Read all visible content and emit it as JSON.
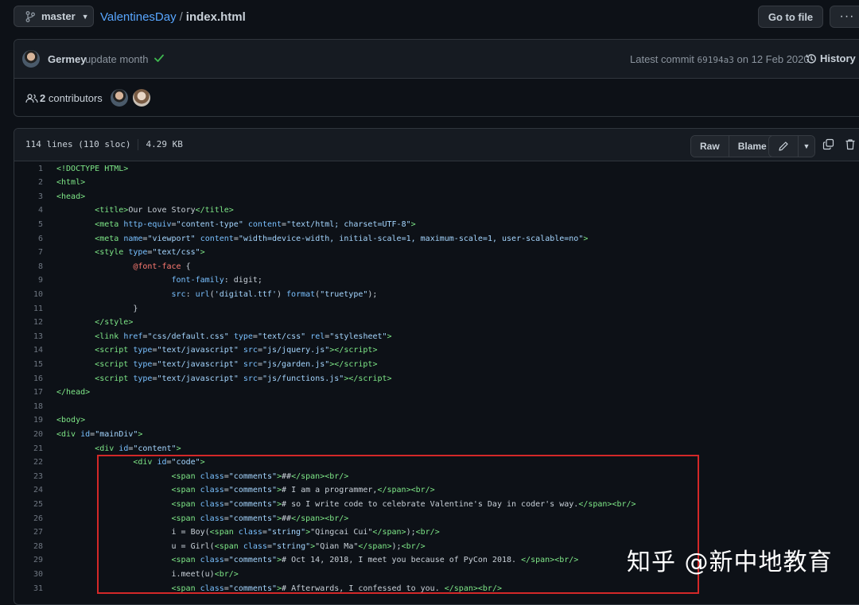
{
  "topbar": {
    "branch": "master",
    "repo": "ValentinesDay",
    "separator": "/",
    "file": "index.html",
    "goto_label": "Go to file",
    "more_label": "···"
  },
  "commit": {
    "author": "Germey",
    "message": "update month",
    "latest_prefix": "Latest commit",
    "sha": "69194a3",
    "date": "on 12 Feb 2020",
    "history_label": "History"
  },
  "contributors": {
    "count": "2",
    "label": "contributors"
  },
  "file_header": {
    "lines": "114 lines (110 sloc)",
    "size": "4.29 KB",
    "raw_label": "Raw",
    "blame_label": "Blame"
  },
  "code_lines": [
    {
      "n": "1",
      "html": "<span class='t'>&lt;!DOCTYPE HTML&gt;</span>"
    },
    {
      "n": "2",
      "html": "<span class='t'>&lt;html&gt;</span>"
    },
    {
      "n": "3",
      "html": "<span class='t'>&lt;head&gt;</span>"
    },
    {
      "n": "4",
      "html": "        <span class='t'>&lt;title&gt;</span>Our Love Story<span class='t'>&lt;/title&gt;</span>"
    },
    {
      "n": "5",
      "html": "        <span class='t'>&lt;meta</span> <span class='a'>http-equiv</span>=<span class='s'>\"content-type\"</span> <span class='a'>content</span>=<span class='s'>\"text/html; charset=UTF-8\"</span><span class='t'>&gt;</span>"
    },
    {
      "n": "6",
      "html": "        <span class='t'>&lt;meta</span> <span class='a'>name</span>=<span class='s'>\"viewport\"</span> <span class='a'>content</span>=<span class='s'>\"width=device-width, initial-scale=1, maximum-scale=1, user-scalable=no\"</span><span class='t'>&gt;</span>"
    },
    {
      "n": "7",
      "html": "        <span class='t'>&lt;style</span> <span class='a'>type</span>=<span class='s'>\"text/css\"</span><span class='t'>&gt;</span>"
    },
    {
      "n": "8",
      "html": "                <span class='k'>@font-face</span> {"
    },
    {
      "n": "9",
      "html": "                        <span class='a'>font-family</span>: digit;"
    },
    {
      "n": "10",
      "html": "                        <span class='a'>src</span>: <span class='a'>url</span>(<span class='s'>'digital.ttf'</span>) <span class='a'>format</span>(<span class='s'>\"truetype\"</span>);"
    },
    {
      "n": "11",
      "html": "                }"
    },
    {
      "n": "12",
      "html": "        <span class='t'>&lt;/style&gt;</span>"
    },
    {
      "n": "13",
      "html": "        <span class='t'>&lt;link</span> <span class='a'>href</span>=<span class='s'>\"css/default.css\"</span> <span class='a'>type</span>=<span class='s'>\"text/css\"</span> <span class='a'>rel</span>=<span class='s'>\"stylesheet\"</span><span class='t'>&gt;</span>"
    },
    {
      "n": "14",
      "html": "        <span class='t'>&lt;script</span> <span class='a'>type</span>=<span class='s'>\"text/javascript\"</span> <span class='a'>src</span>=<span class='s'>\"js/jquery.js\"</span><span class='t'>&gt;&lt;/script&gt;</span>"
    },
    {
      "n": "15",
      "html": "        <span class='t'>&lt;script</span> <span class='a'>type</span>=<span class='s'>\"text/javascript\"</span> <span class='a'>src</span>=<span class='s'>\"js/garden.js\"</span><span class='t'>&gt;&lt;/script&gt;</span>"
    },
    {
      "n": "16",
      "html": "        <span class='t'>&lt;script</span> <span class='a'>type</span>=<span class='s'>\"text/javascript\"</span> <span class='a'>src</span>=<span class='s'>\"js/functions.js\"</span><span class='t'>&gt;&lt;/script&gt;</span>"
    },
    {
      "n": "17",
      "html": "<span class='t'>&lt;/head&gt;</span>"
    },
    {
      "n": "18",
      "html": ""
    },
    {
      "n": "19",
      "html": "<span class='t'>&lt;body&gt;</span>"
    },
    {
      "n": "20",
      "html": "<span class='t'>&lt;div</span> <span class='a'>id</span>=<span class='s'>\"mainDiv\"</span><span class='t'>&gt;</span>"
    },
    {
      "n": "21",
      "html": "        <span class='t'>&lt;div</span> <span class='a'>id</span>=<span class='s'>\"content\"</span><span class='t'>&gt;</span>"
    },
    {
      "n": "22",
      "html": "                <span class='t'>&lt;div</span> <span class='a'>id</span>=<span class='s'>\"code\"</span><span class='t'>&gt;</span>"
    },
    {
      "n": "23",
      "html": "                        <span class='t'>&lt;span</span> <span class='a'>class</span>=<span class='s'>\"comments\"</span><span class='t'>&gt;</span>##<span class='t'>&lt;/span&gt;&lt;br/&gt;</span>"
    },
    {
      "n": "24",
      "html": "                        <span class='t'>&lt;span</span> <span class='a'>class</span>=<span class='s'>\"comments\"</span><span class='t'>&gt;</span># I am a programmer,<span class='t'>&lt;/span&gt;&lt;br/&gt;</span>"
    },
    {
      "n": "25",
      "html": "                        <span class='t'>&lt;span</span> <span class='a'>class</span>=<span class='s'>\"comments\"</span><span class='t'>&gt;</span># so I write code to celebrate Valentine's Day in coder's way.<span class='t'>&lt;/span&gt;&lt;br/&gt;</span>"
    },
    {
      "n": "26",
      "html": "                        <span class='t'>&lt;span</span> <span class='a'>class</span>=<span class='s'>\"comments\"</span><span class='t'>&gt;</span>##<span class='t'>&lt;/span&gt;&lt;br/&gt;</span>"
    },
    {
      "n": "27",
      "html": "                        i = Boy(<span class='t'>&lt;span</span> <span class='a'>class</span>=<span class='s'>\"string\"</span><span class='t'>&gt;</span>\"Qingcai Cui\"<span class='t'>&lt;/span&gt;</span>);<span class='t'>&lt;br/&gt;</span>"
    },
    {
      "n": "28",
      "html": "                        u = Girl(<span class='t'>&lt;span</span> <span class='a'>class</span>=<span class='s'>\"string\"</span><span class='t'>&gt;</span>\"Qian Ma\"<span class='t'>&lt;/span&gt;</span>);<span class='t'>&lt;br/&gt;</span>"
    },
    {
      "n": "29",
      "html": "                        <span class='t'>&lt;span</span> <span class='a'>class</span>=<span class='s'>\"comments\"</span><span class='t'>&gt;</span># Oct 14, 2018, I meet you because of PyCon 2018. <span class='t'>&lt;/span&gt;&lt;br/&gt;</span>"
    },
    {
      "n": "30",
      "html": "                        i.meet(u)<span class='t'>&lt;br/&gt;</span>"
    },
    {
      "n": "31",
      "html": "                        <span class='t'>&lt;span</span> <span class='a'>class</span>=<span class='s'>\"comments\"</span><span class='t'>&gt;</span># Afterwards, I confessed to you. <span class='t'>&lt;/span&gt;&lt;br/&gt;</span>"
    }
  ],
  "watermark": "知乎 @新中地教育",
  "colors": {
    "background": "#0d1117",
    "link": "#58a6ff",
    "highlight_border": "#d32828",
    "check": "#3fb950"
  }
}
